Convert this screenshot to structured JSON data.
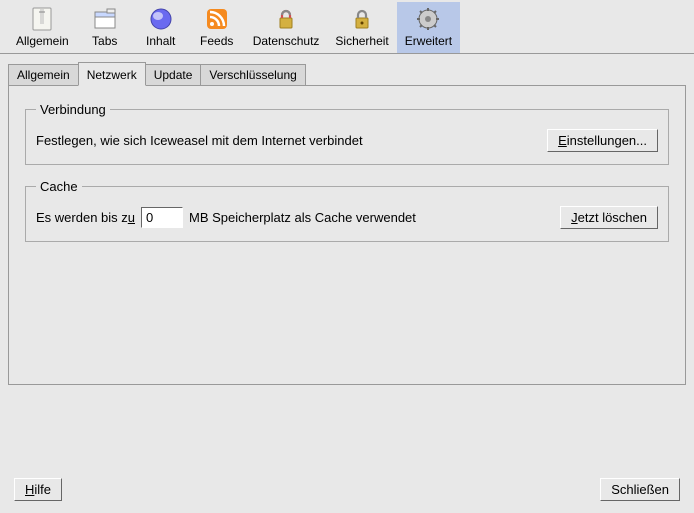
{
  "toolbar": {
    "items": [
      {
        "label": "Allgemein",
        "icon": "preferences"
      },
      {
        "label": "Tabs",
        "icon": "tabs"
      },
      {
        "label": "Inhalt",
        "icon": "globe"
      },
      {
        "label": "Feeds",
        "icon": "feeds"
      },
      {
        "label": "Datenschutz",
        "icon": "privacy"
      },
      {
        "label": "Sicherheit",
        "icon": "security"
      },
      {
        "label": "Erweitert",
        "icon": "advanced"
      }
    ],
    "selected_index": 6
  },
  "tabs": {
    "items": [
      "Allgemein",
      "Netzwerk",
      "Update",
      "Verschlüsselung"
    ],
    "active_index": 1
  },
  "connection": {
    "legend": "Verbindung",
    "text": "Festlegen, wie sich Iceweasel mit dem Internet verbindet",
    "settings_btn": "Einstellungen..."
  },
  "cache": {
    "legend": "Cache",
    "text_before": "Es werden bis zu",
    "text_before_accesskey": "u",
    "value": "0",
    "text_after": "MB Speicherplatz als Cache verwendet",
    "clear_btn": "Jetzt löschen"
  },
  "buttons": {
    "help": "Hilfe",
    "help_accesskey": "H",
    "close": "Schließen"
  }
}
